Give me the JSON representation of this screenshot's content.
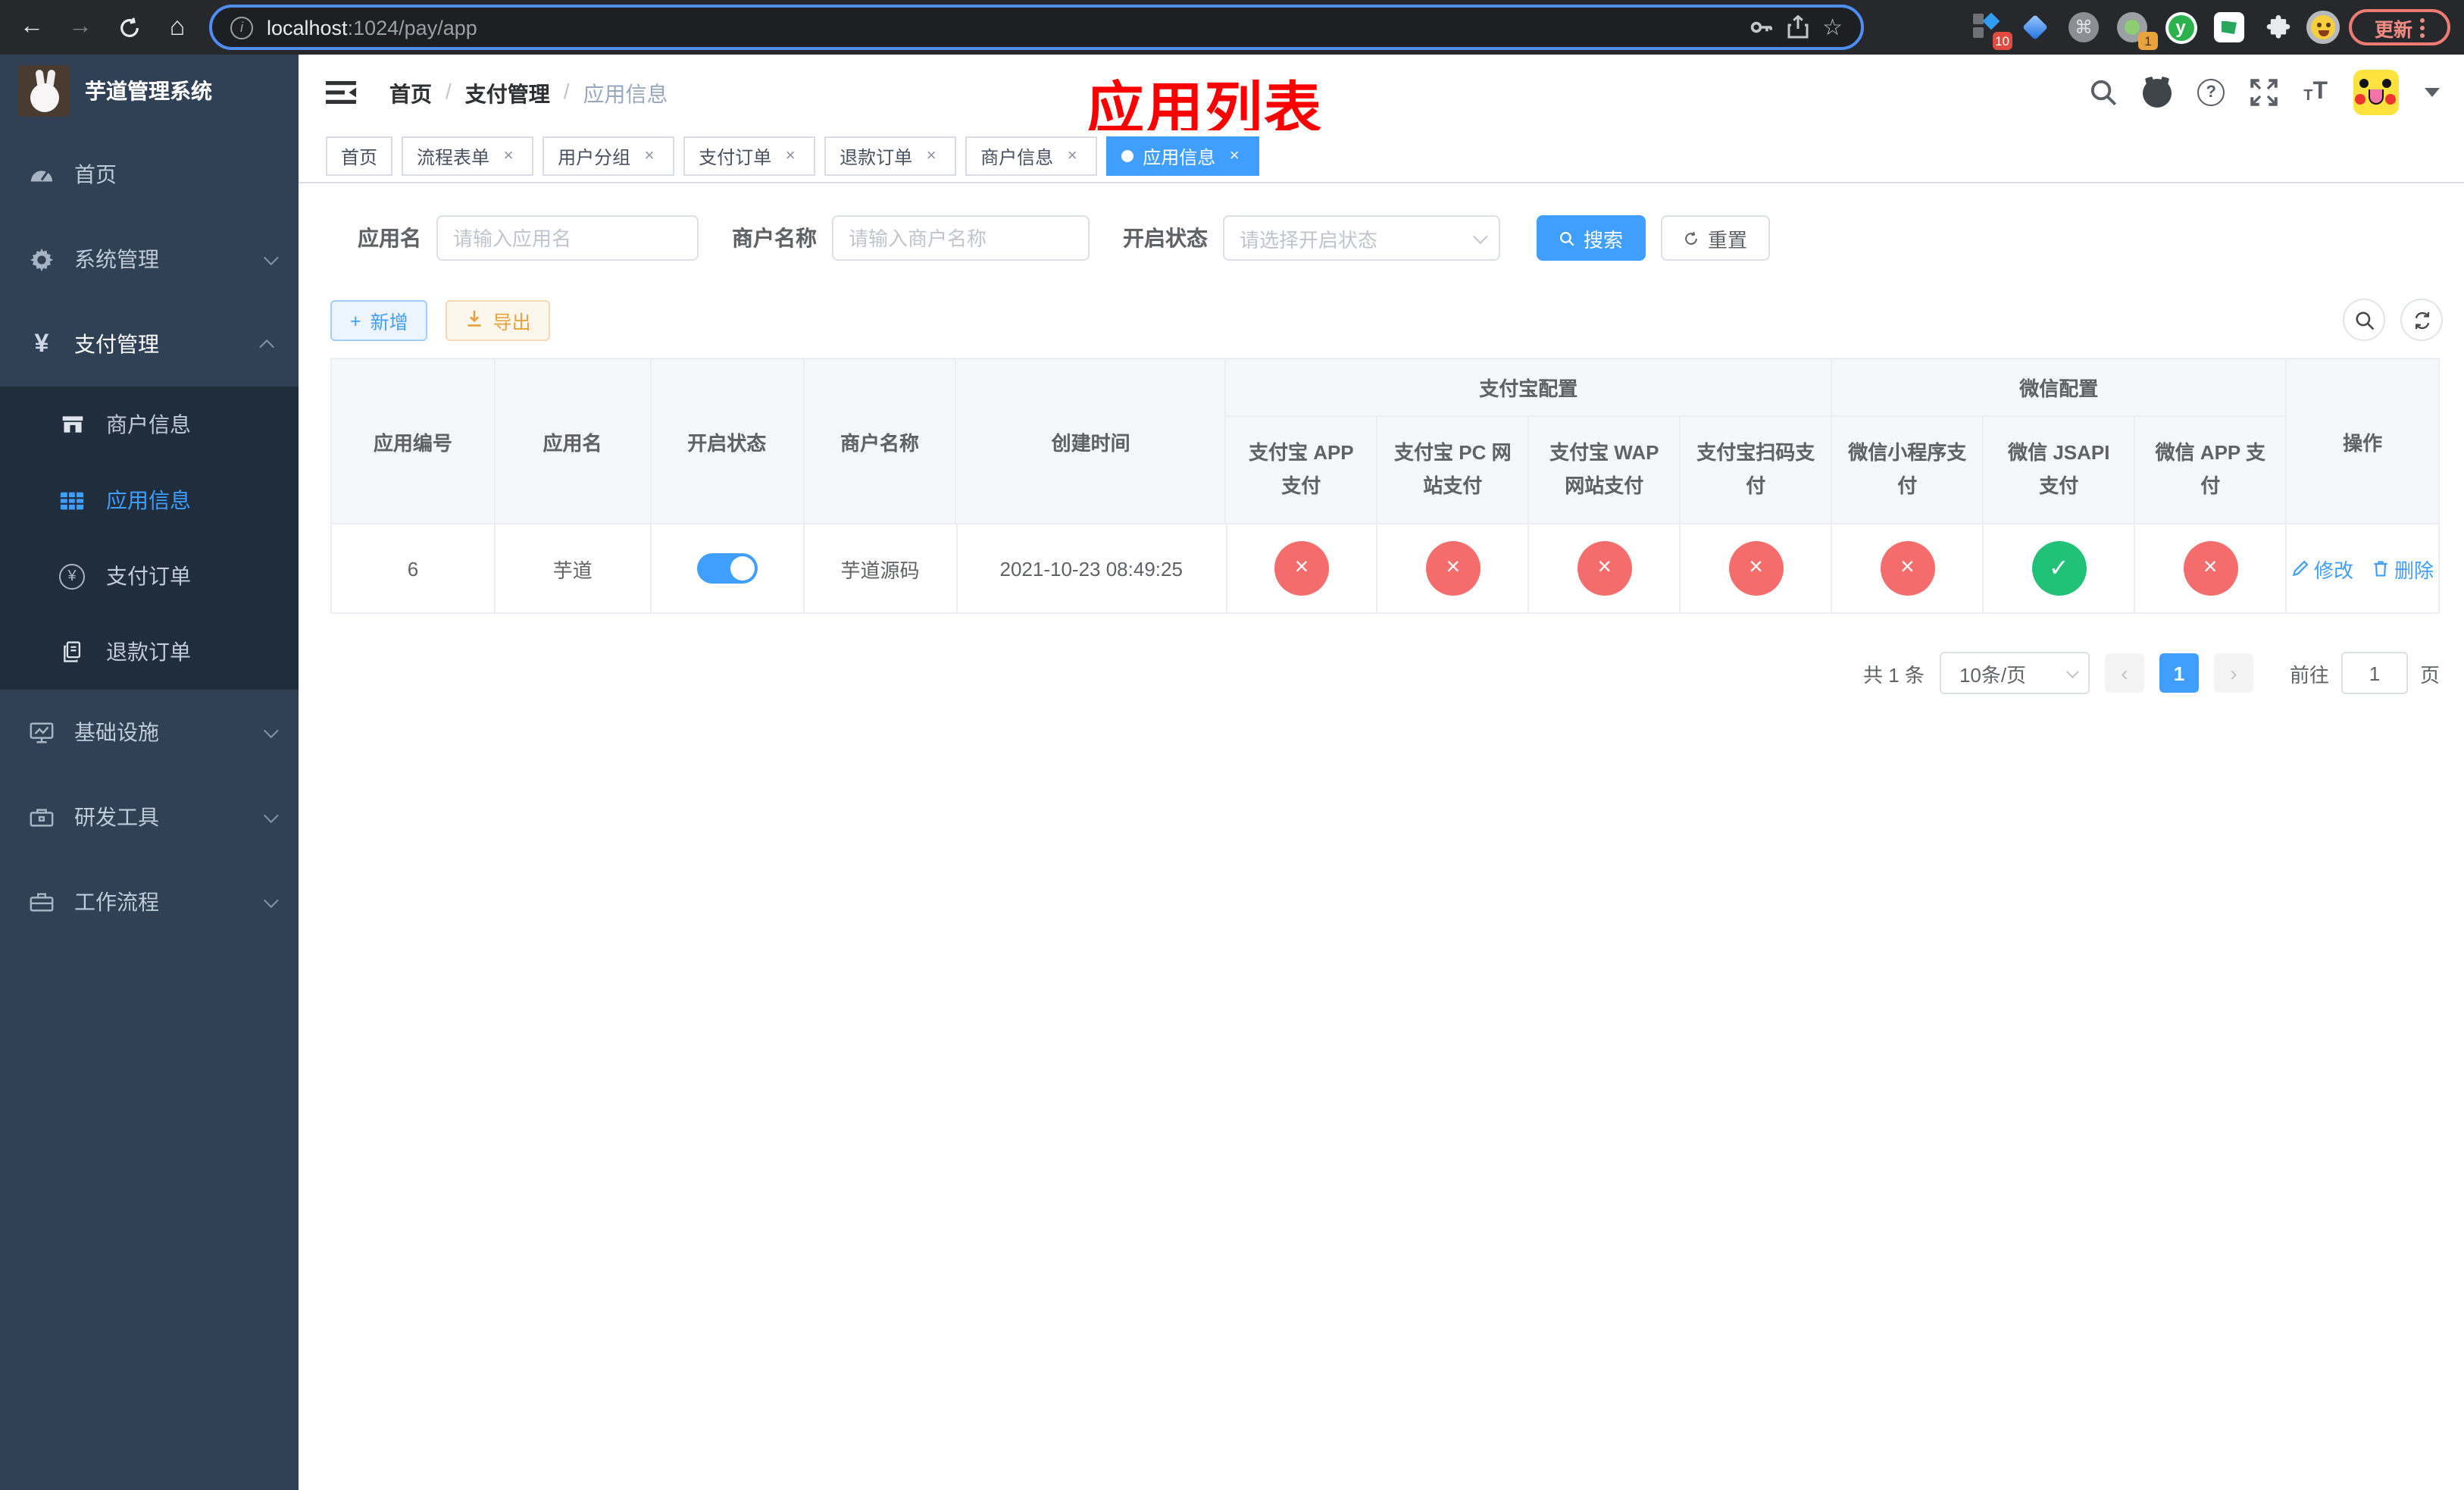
{
  "browser": {
    "url_host": "localhost",
    "url_rest": ":1024/pay/app",
    "ext_badge_count": "10",
    "profile_badge_count": "1",
    "update_label": "更新"
  },
  "icons": {
    "back": "←",
    "forward": "→",
    "home": "⌂",
    "star": "☆",
    "info": "i",
    "command": "⌘",
    "yuque": "y",
    "question": "?",
    "font_small": "T",
    "font_big": "T",
    "yen": "¥",
    "plus": "+",
    "prev": "‹",
    "next": "›"
  },
  "sidebar": {
    "title": "芋道管理系统",
    "menu": [
      {
        "label": "首页"
      },
      {
        "label": "系统管理"
      },
      {
        "label": "支付管理"
      },
      {
        "label": "基础设施"
      },
      {
        "label": "研发工具"
      },
      {
        "label": "工作流程"
      }
    ],
    "payment_children": [
      {
        "label": "商户信息"
      },
      {
        "label": "应用信息"
      },
      {
        "label": "支付订单"
      },
      {
        "label": "退款订单"
      }
    ]
  },
  "header": {
    "breadcrumb": [
      "首页",
      "支付管理",
      "应用信息"
    ],
    "separator": "/",
    "annotation": "应用列表"
  },
  "tabs": [
    {
      "label": "首页"
    },
    {
      "label": "流程表单"
    },
    {
      "label": "用户分组"
    },
    {
      "label": "支付订单"
    },
    {
      "label": "退款订单"
    },
    {
      "label": "商户信息"
    },
    {
      "label": "应用信息"
    }
  ],
  "filters": {
    "app_name_label": "应用名",
    "app_name_placeholder": "请输入应用名",
    "merchant_label": "商户名称",
    "merchant_placeholder": "请输入商户名称",
    "status_label": "开启状态",
    "status_placeholder": "请选择开启状态",
    "search_button": "搜索",
    "reset_button": "重置"
  },
  "toolbar": {
    "add_label": "新增",
    "export_label": "导出"
  },
  "table": {
    "plain_columns": [
      "应用编号",
      "应用名",
      "开启状态",
      "商户名称",
      "创建时间"
    ],
    "groups": [
      {
        "label": "支付宝配置",
        "columns": [
          "支付宝 APP 支付",
          "支付宝 PC 网站支付",
          "支付宝 WAP 网站支付",
          "支付宝扫码支付"
        ]
      },
      {
        "label": "微信配置",
        "columns": [
          "微信小程序支付",
          "微信 JSAPI 支付",
          "微信 APP 支付"
        ]
      }
    ],
    "action_label": "操作",
    "rows": [
      {
        "id": "6",
        "name": "芋道",
        "enabled": true,
        "merchant": "芋道源码",
        "created_at": "2021-10-23 08:49:25",
        "statuses": [
          false,
          false,
          false,
          false,
          false,
          true,
          false
        ],
        "edit_label": "修改",
        "delete_label": "删除"
      }
    ]
  },
  "pagination": {
    "total": "共 1 条",
    "page_size": "10条/页",
    "current_page": "1",
    "goto_label": "前往",
    "goto_value": "1",
    "unit_label": "页"
  },
  "colors": {
    "accent": "#409eff",
    "success": "#22c178",
    "danger": "#f56c6c",
    "warning": "#e6a23c",
    "sidebar_bg": "#304156",
    "submenu_bg": "#1f2d3d"
  }
}
